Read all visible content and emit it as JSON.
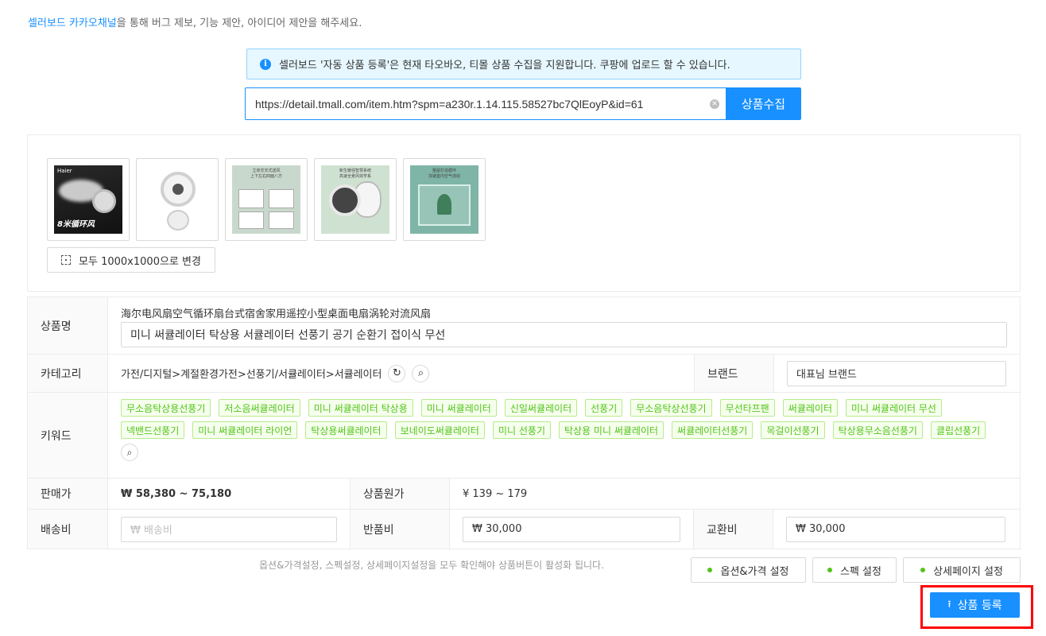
{
  "notice": {
    "link_text": "셀러보드 카카오채널",
    "rest_text": "을 통해 버그 제보, 기능 제안, 아이디어 제안을 해주세요."
  },
  "info": {
    "text": "셀러보드 '자동 상품 등록'은 현재 타오바오, 티몰 상품 수집을 지원합니다. 쿠팡에 업로드 할 수 있습니다."
  },
  "collect": {
    "url_value": "https://detail.tmall.com/item.htm?spm=a230r.1.14.115.58527bc7QlEoyP&id=61",
    "button_label": "상품수집"
  },
  "images": {
    "thumb1_brand": "Haier",
    "thumb1_label": "8米循环风",
    "thumb3_text": "立体交叉式送风\n上下左右四面八方",
    "thumb4_text": "新生暖强智慧系统\n高速全景风效学系",
    "thumb5_text": "整屋打造循环\n加速室内空气流动",
    "resize_button": "모두 1000x1000으로 변경"
  },
  "product": {
    "name_label": "상품명",
    "original_title": "海尔电风扇空气循环扇台式宿舍家用遥控小型桌面电扇涡轮对流风扇",
    "name_value": "미니 써큘레이터 탁상용 서큘레이터 선풍기 공기 순환기 접이식 무선",
    "category_label": "카테고리",
    "category_path": "가전/디지털>계절환경가전>선풍기/서큘레이터>서큘레이터",
    "brand_label": "브랜드",
    "brand_value": "대표님 브랜드",
    "keyword_label": "키워드",
    "keywords": [
      "무소음탁상용선풍기",
      "저소음써큘레이터",
      "미니 써큘레이터 탁상용",
      "미니 써큘레이터",
      "신일써큘레이터",
      "선풍기",
      "무소음탁상선풍기",
      "무선타프팬",
      "써큘레이터",
      "미니 써큘레이터 무선",
      "넥밴드선풍기",
      "미니 써큘레이터 라이언",
      "탁상용써큘레이터",
      "보네이도써큘레이터",
      "미니 선풍기",
      "탁상용 미니 써큘레이터",
      "써큘레이터선풍기",
      "목걸이선풍기",
      "탁상용무소음선풍기",
      "클립선풍기"
    ],
    "price_label": "판매가",
    "price_value": "₩ 58,380 ~ 75,180",
    "orig_price_label": "상품원가",
    "orig_price_value": "¥ 139 ~ 179",
    "shipping_label": "배송비",
    "shipping_placeholder": "₩ 배송비",
    "return_label": "반품비",
    "return_value": "₩ 30,000",
    "exchange_label": "교환비",
    "exchange_value": "₩ 30,000"
  },
  "footer": {
    "hint": "옵션&가격설정, 스펙설정, 상세페이지설정을 모두 확인해야 상품버튼이 활성화 됩니다.",
    "option_button": "옵션&가격 설정",
    "spec_button": "스펙 설정",
    "detail_button": "상세페이지 설정",
    "register_button": "상품 등록"
  },
  "colors": {
    "accent": "#1890ff",
    "tag_green": "#52c41a",
    "highlight_red": "#ff0000"
  }
}
